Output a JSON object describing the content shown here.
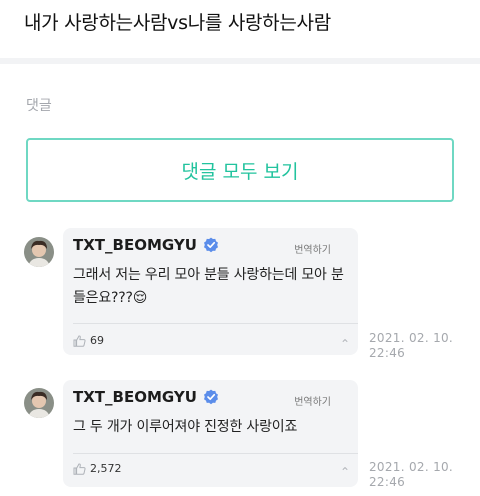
{
  "post": {
    "title": "내가 사랑하는사람vs나를 사랑하는사람"
  },
  "comments_section": {
    "label": "댓글",
    "view_all_label": "댓글 모두 보기",
    "accent_color": "#22c39e"
  },
  "comments": [
    {
      "author": "TXT_BEOMGYU",
      "verified": true,
      "translate_label": "번역하기",
      "text": "그래서 저는 우리 모아 분들 사랑하는데 모아 분들은요???😌",
      "likes": "69",
      "more_label": "⌃",
      "date": "2021. 02. 10.",
      "time": "22:46"
    },
    {
      "author": "TXT_BEOMGYU",
      "verified": true,
      "translate_label": "번역하기",
      "text": "그 두 개가 이루어져야 진정한 사랑이죠",
      "likes": "2,572",
      "more_label": "⌃",
      "date": "2021. 02. 10.",
      "time": "22:46"
    }
  ],
  "icons": {
    "verified": "verified-badge-icon",
    "like": "thumbs-up-icon",
    "more": "chevron-up-icon",
    "avatar": "avatar"
  }
}
